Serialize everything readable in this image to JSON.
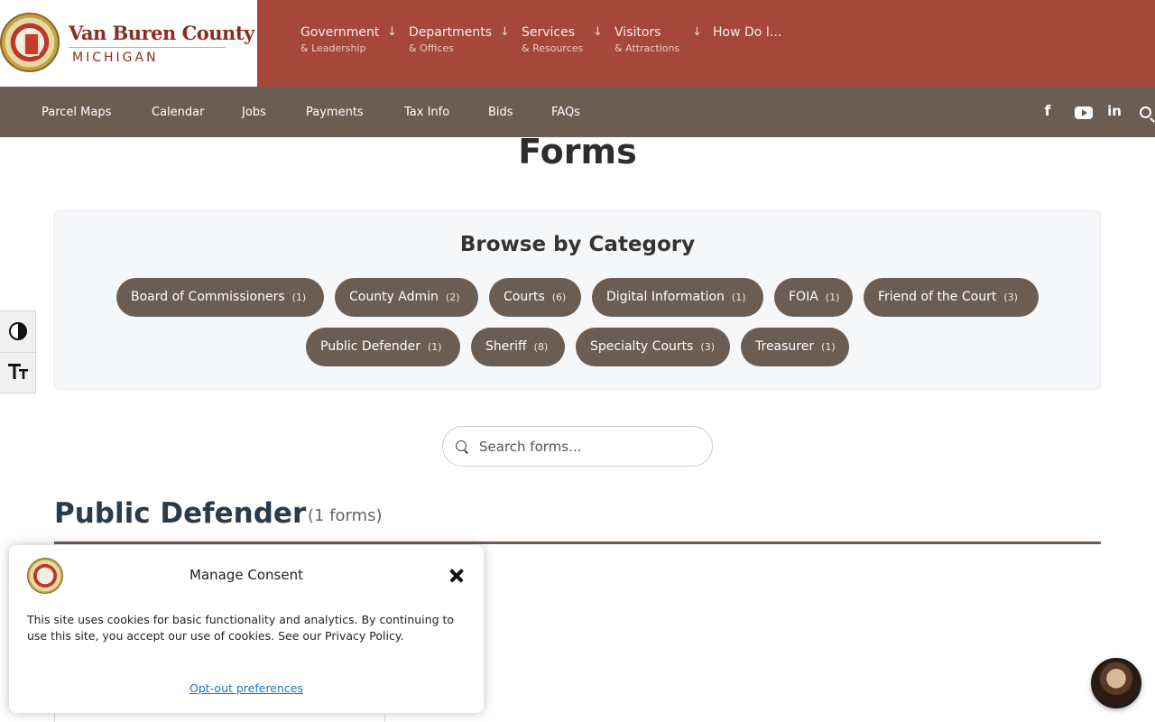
{
  "brand": {
    "title": "Van Buren County",
    "subtitle": "MICHIGAN"
  },
  "main_nav": [
    {
      "label": "Government",
      "sub": "& Leadership",
      "arrow": "↓"
    },
    {
      "label": "Departments",
      "sub": "& Offices",
      "arrow": "↓"
    },
    {
      "label": "Services",
      "sub": "& Resources",
      "arrow": "↓"
    },
    {
      "label": "Visitors",
      "sub": "& Attractions",
      "arrow": "↓"
    },
    {
      "label": "How Do I..."
    }
  ],
  "sub_nav": [
    "Parcel Maps",
    "Calendar",
    "Jobs",
    "Payments",
    "Tax Info",
    "Bids",
    "FAQs"
  ],
  "social": {
    "facebook": "f",
    "linkedin": "in"
  },
  "page": {
    "title": "Forms"
  },
  "categories": {
    "title": "Browse by Category",
    "items": [
      {
        "label": "Board of Commissioners",
        "count": "(1)"
      },
      {
        "label": "County Admin",
        "count": "(2)"
      },
      {
        "label": "Courts",
        "count": "(6)"
      },
      {
        "label": "Digital Information",
        "count": "(1)"
      },
      {
        "label": "FOIA",
        "count": "(1)"
      },
      {
        "label": "Friend of the Court",
        "count": "(3)"
      },
      {
        "label": "Public Defender",
        "count": "(1)"
      },
      {
        "label": "Sheriff",
        "count": "(8)"
      },
      {
        "label": "Specialty Courts",
        "count": "(3)"
      },
      {
        "label": "Treasurer",
        "count": "(1)"
      }
    ]
  },
  "search": {
    "placeholder": "Search forms..."
  },
  "section": {
    "title": "Public Defender",
    "count": "(1 forms)"
  },
  "consent": {
    "title": "Manage Consent",
    "body": "This site uses cookies for basic functionality and analytics. By continuing to use this site, you accept our use of cookies. See our Privacy Policy.",
    "link": "Opt-out preferences"
  },
  "colors": {
    "header": "#a5483a",
    "subnav": "#6c5d53",
    "pill": "#6c5d53",
    "section_title": "#2a3b4c"
  }
}
